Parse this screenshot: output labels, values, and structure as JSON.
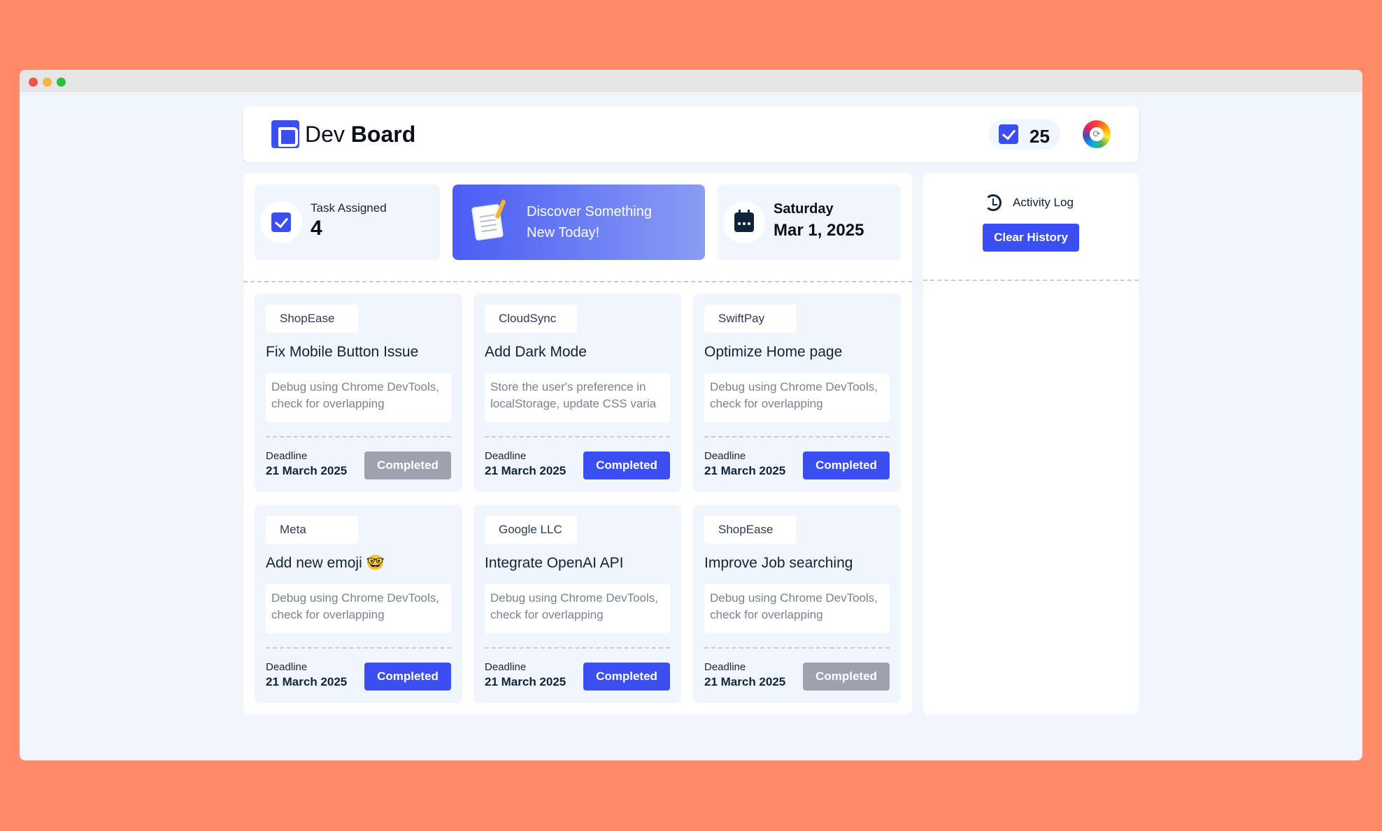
{
  "header": {
    "logo_regular": "Dev",
    "logo_bold": "Board",
    "completed_count": "25"
  },
  "stats": {
    "task_label": "Task Assigned",
    "task_count": "4",
    "discover_line1": "Discover Something",
    "discover_line2": "New Today!",
    "day": "Saturday",
    "date": "Mar 1, 2025"
  },
  "activity": {
    "title": "Activity Log",
    "clear_label": "Clear History"
  },
  "tasks": [
    {
      "company": "ShopEase",
      "title": "Fix Mobile Button Issue",
      "desc1": "Debug using Chrome DevTools,",
      "desc2": "check for overlapping",
      "deadline_label": "Deadline",
      "deadline": "21 March 2025",
      "status": "Completed",
      "done": true
    },
    {
      "company": "CloudSync",
      "title": "Add Dark Mode",
      "desc1": "Store the user's preference in",
      "desc2": "localStorage, update CSS varia",
      "deadline_label": "Deadline",
      "deadline": "21 March 2025",
      "status": "Completed",
      "done": false
    },
    {
      "company": "SwiftPay",
      "title": "Optimize Home page",
      "desc1": "Debug using Chrome DevTools,",
      "desc2": "check for overlapping",
      "deadline_label": "Deadline",
      "deadline": "21 March 2025",
      "status": "Completed",
      "done": false
    },
    {
      "company": "Meta",
      "title": "Add new emoji 🤓",
      "desc1": "Debug using Chrome DevTools,",
      "desc2": "check for overlapping",
      "deadline_label": "Deadline",
      "deadline": "21 March 2025",
      "status": "Completed",
      "done": false
    },
    {
      "company": "Google LLC",
      "title": "Integrate OpenAI API",
      "desc1": "Debug using Chrome DevTools,",
      "desc2": "check for overlapping",
      "deadline_label": "Deadline",
      "deadline": "21 March 2025",
      "status": "Completed",
      "done": false
    },
    {
      "company": "ShopEase",
      "title": "Improve Job searching",
      "desc1": "Debug using Chrome DevTools,",
      "desc2": "check for overlapping",
      "deadline_label": "Deadline",
      "deadline": "21 March 2025",
      "status": "Completed",
      "done": true
    }
  ],
  "colors": {
    "accent": "#3b4ef2",
    "completed_disabled": "#9ca3af",
    "page_bg": "#ff8a6a",
    "app_bg": "#f1f5fd"
  }
}
